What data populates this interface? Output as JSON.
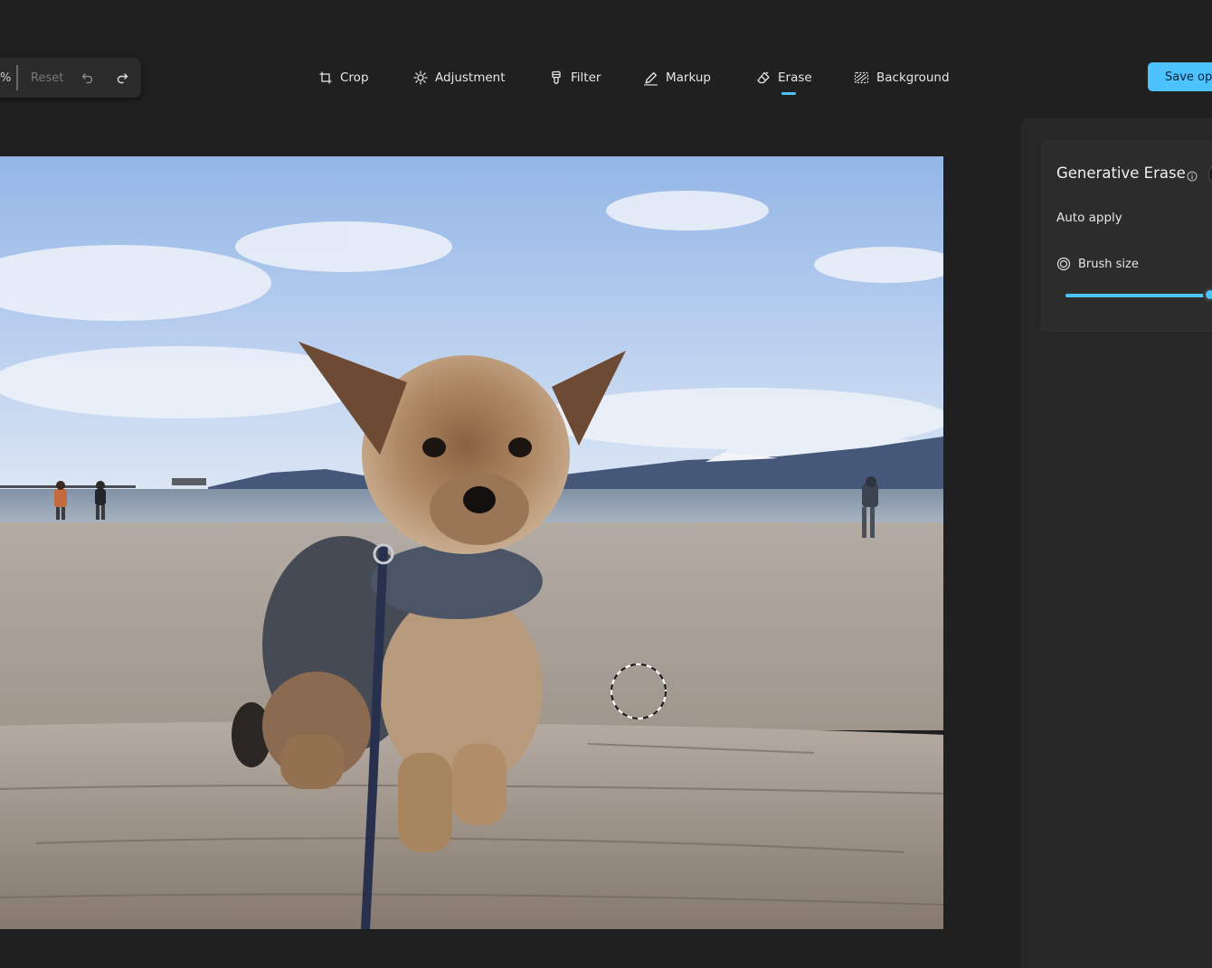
{
  "zoom": {
    "percent_label": "%",
    "reset_label": "Reset"
  },
  "toolbar": {
    "crop_label": "Crop",
    "adjustment_label": "Adjustment",
    "filter_label": "Filter",
    "markup_label": "Markup",
    "erase_label": "Erase",
    "background_label": "Background",
    "active_tool": "Erase"
  },
  "save": {
    "label": "Save opt"
  },
  "panel": {
    "title": "Generative Erase",
    "auto_apply_label": "Auto apply",
    "brush_size_label": "Brush size",
    "brush_size_fraction": 1.0
  },
  "icons": {
    "undo": "undo-icon",
    "redo": "redo-icon",
    "crop": "crop-icon",
    "adjustment": "brightness-icon",
    "filter": "filter-icon",
    "markup": "pen-icon",
    "erase": "eraser-icon",
    "background": "background-icon",
    "info": "info-icon",
    "brush": "brush-size-icon"
  },
  "colors": {
    "accent": "#4cc2ff",
    "background": "#202020",
    "panel": "#272727"
  }
}
